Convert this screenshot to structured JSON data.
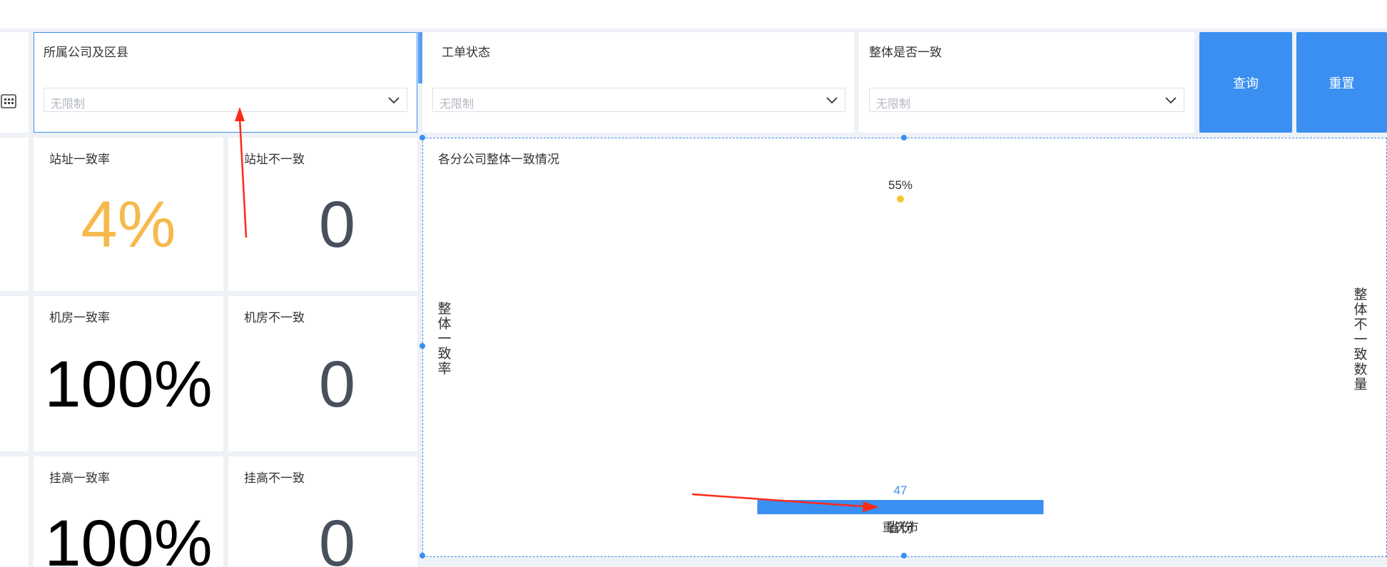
{
  "filters": {
    "company": {
      "label": "所属公司及区县",
      "placeholder": "无限制"
    },
    "order_status": {
      "label": "工单状态",
      "placeholder": "无限制"
    },
    "overall_consistent": {
      "label": "整体是否一致",
      "placeholder": "无限制"
    }
  },
  "buttons": {
    "query": "查询",
    "reset": "重置"
  },
  "cards": [
    {
      "title": "站址一致率",
      "value": "4%",
      "color": "#f6b94c"
    },
    {
      "title": "站址不一致",
      "value": "0",
      "color": "#48505e"
    },
    {
      "title": "机房一致率",
      "value": "100%",
      "color": "#000000"
    },
    {
      "title": "机房不一致",
      "value": "0",
      "color": "#48505e"
    },
    {
      "title": "挂高一致率",
      "value": "100%",
      "color": "#000000"
    },
    {
      "title": "挂高不一致",
      "value": "0",
      "color": "#48505e"
    }
  ],
  "chart_data": {
    "type": "bar",
    "title": "各分公司整体一致情况",
    "xlabel": "省份",
    "ylabel": "整体一致率",
    "ylabel_right": "整体不一致数量",
    "categories": [
      "重庆市"
    ],
    "series": [
      {
        "name": "整体不一致数量",
        "type": "bar",
        "values": [
          47
        ],
        "labels": [
          "47"
        ],
        "color": "#3a8ff0"
      },
      {
        "name": "整体一致率",
        "type": "line",
        "values": [
          0.55
        ],
        "labels": [
          "55%"
        ],
        "color": "#f7c531"
      }
    ],
    "grid": false
  },
  "colors": {
    "accent": "#3a8ff0",
    "annotation_arrow": "#ff2a1a"
  }
}
